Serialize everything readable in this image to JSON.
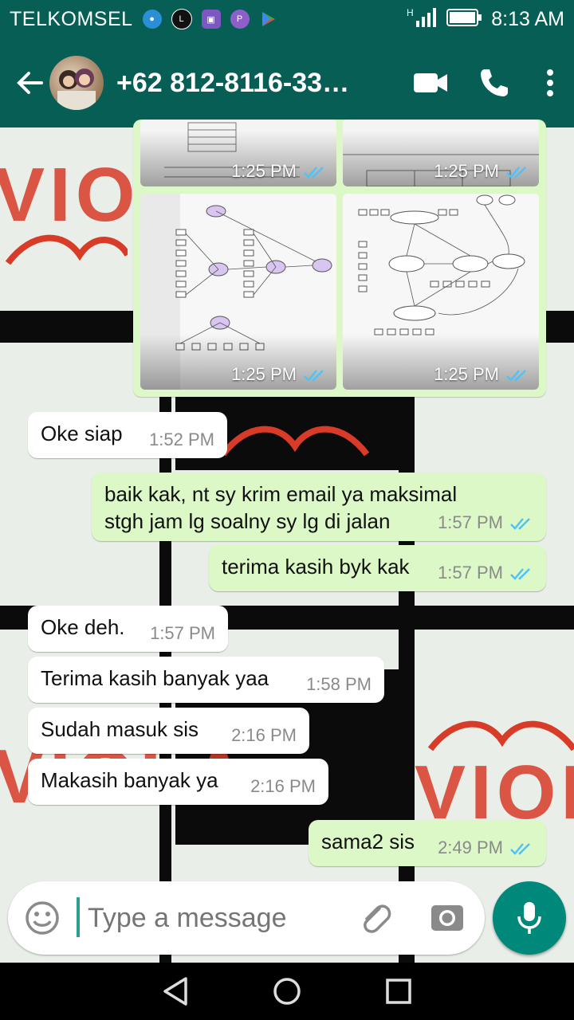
{
  "status_bar": {
    "carrier": "TELKOMSEL",
    "time": "8:13 AM",
    "network": "H"
  },
  "header": {
    "contact": "+62 812-8116-33…"
  },
  "image_messages": [
    {
      "time": "1:25 PM"
    },
    {
      "time": "1:25 PM"
    },
    {
      "time": "1:25 PM"
    },
    {
      "time": "1:25 PM"
    }
  ],
  "messages": [
    {
      "dir": "in",
      "text": "Oke siap",
      "time": "1:52 PM"
    },
    {
      "dir": "out",
      "text": "baik kak, nt sy krim email ya maksimal stgh jam lg soalny sy lg di jalan",
      "time": "1:57 PM"
    },
    {
      "dir": "out",
      "text": "terima kasih byk kak",
      "time": "1:57 PM"
    },
    {
      "dir": "in",
      "text": "Oke deh.",
      "time": "1:57 PM"
    },
    {
      "dir": "in",
      "text": "Terima kasih banyak yaa",
      "time": "1:58 PM"
    },
    {
      "dir": "in",
      "text": "Sudah masuk sis",
      "time": "2:16 PM"
    },
    {
      "dir": "in",
      "text": "Makasih banyak ya",
      "time": "2:16 PM"
    },
    {
      "dir": "out",
      "text": "sama2 sis",
      "time": "2:49 PM"
    }
  ],
  "composer": {
    "placeholder": "Type a message"
  },
  "background": {
    "watermark": "VIOLA"
  },
  "colors": {
    "header": "#075e54",
    "outgoing": "#dcf8c6",
    "incoming": "#ffffff",
    "fab": "#00897b",
    "read_ticks": "#4fc3f7"
  }
}
